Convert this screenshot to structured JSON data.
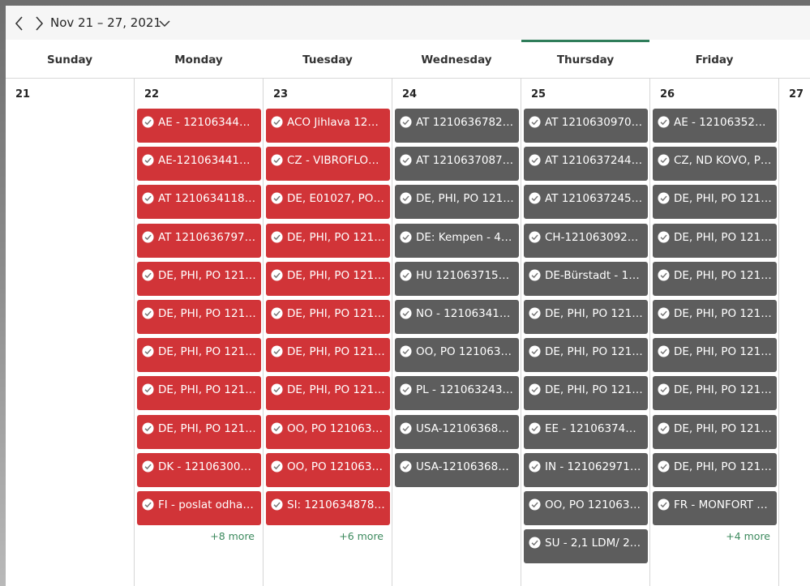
{
  "toolbar": {
    "prev_icon": "chevron-left-icon",
    "next_icon": "chevron-right-icon",
    "date_range": "Nov 21 – 27, 2021",
    "dropdown_icon": "chevron-down-icon"
  },
  "days": [
    {
      "name": "Sunday",
      "date": "21",
      "more": "",
      "events": []
    },
    {
      "name": "Monday",
      "date": "22",
      "more": "+8 more",
      "events": [
        {
          "title": "AE - 121063441…",
          "color": "red"
        },
        {
          "title": "AE-1210634413-…",
          "color": "red"
        },
        {
          "title": "AT 1210634118, …",
          "color": "red"
        },
        {
          "title": "AT 1210636797, …",
          "color": "red"
        },
        {
          "title": "DE, PHI, PO 121…",
          "color": "red"
        },
        {
          "title": "DE, PHI, PO 121…",
          "color": "red"
        },
        {
          "title": "DE, PHI, PO 121…",
          "color": "red"
        },
        {
          "title": "DE, PHI, PO 121…",
          "color": "red"
        },
        {
          "title": "DE, PHI, PO 121…",
          "color": "red"
        },
        {
          "title": "DK - 121063001…",
          "color": "red"
        },
        {
          "title": "FI - poslat odha…",
          "color": "red"
        }
      ]
    },
    {
      "name": "Tuesday",
      "date": "23",
      "more": "+6 more",
      "events": [
        {
          "title": "ACO Jihlava 121…",
          "color": "red"
        },
        {
          "title": "CZ - VIBROFLOO…",
          "color": "red"
        },
        {
          "title": "DE, E01027, PO …",
          "color": "red"
        },
        {
          "title": "DE, PHI, PO 121…",
          "color": "red"
        },
        {
          "title": "DE, PHI, PO 121…",
          "color": "red"
        },
        {
          "title": "DE, PHI, PO 121…",
          "color": "red"
        },
        {
          "title": "DE, PHI, PO 121…",
          "color": "red"
        },
        {
          "title": "DE, PHI, PO 121…",
          "color": "red"
        },
        {
          "title": "OO, PO 1210632…",
          "color": "red"
        },
        {
          "title": "OO, PO 1210633…",
          "color": "red"
        },
        {
          "title": "SI: 1210634878 …",
          "color": "red"
        }
      ]
    },
    {
      "name": "Wednesday",
      "date": "24",
      "more": "",
      "events": [
        {
          "title": "AT 1210636782, …",
          "color": "gray"
        },
        {
          "title": "AT 1210637087, …",
          "color": "gray"
        },
        {
          "title": "DE, PHI, PO 121…",
          "color": "gray"
        },
        {
          "title": "DE: Kempen - 4l…",
          "color": "gray"
        },
        {
          "title": "HU 1210637153,…",
          "color": "gray"
        },
        {
          "title": "NO - 121063410…",
          "color": "gray"
        },
        {
          "title": "OO, PO 1210633…",
          "color": "gray"
        },
        {
          "title": "PL - 1210632435…",
          "color": "gray"
        },
        {
          "title": "USA-121063688…",
          "color": "gray"
        },
        {
          "title": "USA-121063689…",
          "color": "gray"
        }
      ]
    },
    {
      "name": "Thursday",
      "date": "25",
      "more": "",
      "events": [
        {
          "title": "AT 1210630970, …",
          "color": "gray"
        },
        {
          "title": "AT 1210637244, …",
          "color": "gray"
        },
        {
          "title": "AT 1210637245, …",
          "color": "gray"
        },
        {
          "title": "CH-1210630921…",
          "color": "gray"
        },
        {
          "title": "DE-Bürstadt - 12…",
          "color": "gray"
        },
        {
          "title": "DE, PHI, PO 121…",
          "color": "gray"
        },
        {
          "title": "DE, PHI, PO 121…",
          "color": "gray"
        },
        {
          "title": "DE, PHI, PO 121…",
          "color": "gray"
        },
        {
          "title": "EE - 1210637430…",
          "color": "gray"
        },
        {
          "title": "IN - 1210629712…",
          "color": "gray"
        },
        {
          "title": "OO, PO 1210637…",
          "color": "gray"
        },
        {
          "title": "SU - 2,1 LDM/ 2,…",
          "color": "gray"
        }
      ]
    },
    {
      "name": "Friday",
      "date": "26",
      "more": "+4 more",
      "events": [
        {
          "title": "AE - 121063524…",
          "color": "gray"
        },
        {
          "title": "CZ, ND KOVO, P…",
          "color": "gray"
        },
        {
          "title": "DE, PHI, PO 121…",
          "color": "gray"
        },
        {
          "title": "DE, PHI, PO 121…",
          "color": "gray"
        },
        {
          "title": "DE, PHI, PO 121…",
          "color": "gray"
        },
        {
          "title": "DE, PHI, PO 121…",
          "color": "gray"
        },
        {
          "title": "DE, PHI, PO 121…",
          "color": "gray"
        },
        {
          "title": "DE, PHI, PO 121…",
          "color": "gray"
        },
        {
          "title": "DE, PHI, PO 121…",
          "color": "gray"
        },
        {
          "title": "DE, PHI, PO 121…",
          "color": "gray"
        },
        {
          "title": "FR - MONFORT …",
          "color": "gray"
        }
      ]
    },
    {
      "name": "",
      "date": "27",
      "more": "",
      "events": []
    }
  ],
  "colors": {
    "event_red": "#d13438",
    "event_gray": "#5d5d5d",
    "today_accent": "#2f7d5a",
    "more_link": "#3d8a5e"
  },
  "icons": {
    "event_status": "check-circle-icon"
  }
}
